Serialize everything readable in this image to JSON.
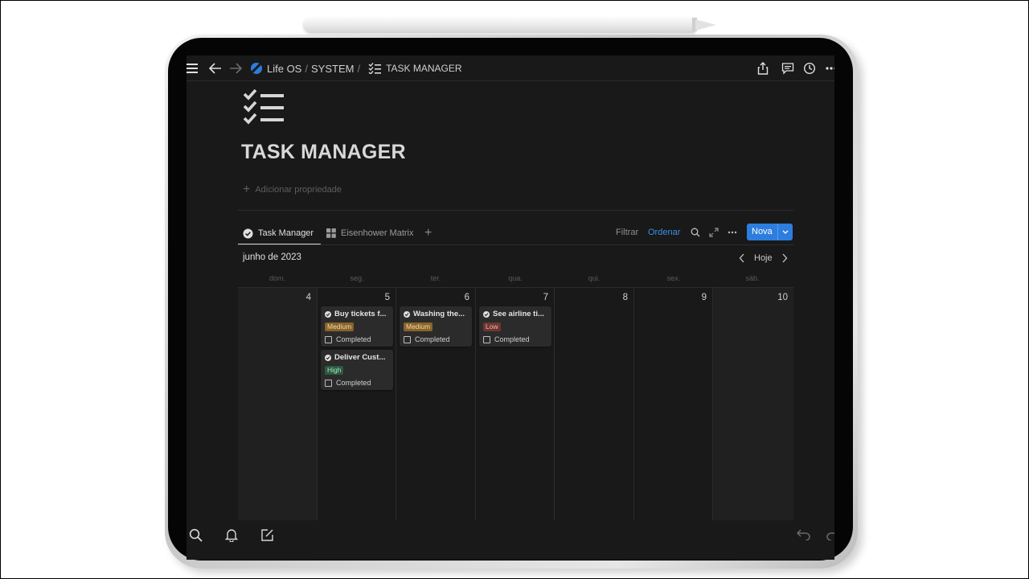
{
  "topbar": {
    "workspace": "Life OS",
    "section": "SYSTEM",
    "separator": "/",
    "page": "TASK MANAGER"
  },
  "page": {
    "title": "TASK MANAGER",
    "add_property": "Adicionar propriedade"
  },
  "views": {
    "tabs": [
      {
        "label": "Task Manager",
        "icon": "check-circle-icon",
        "active": true
      },
      {
        "label": "Eisenhower Matrix",
        "icon": "grid-icon",
        "active": false
      }
    ],
    "filter_label": "Filtrar",
    "sort_label": "Ordenar",
    "new_label": "Nova"
  },
  "calendar": {
    "month": "junho de 2023",
    "today_label": "Hoje",
    "weekdays": [
      "dom.",
      "seg.",
      "ter.",
      "qua.",
      "qui.",
      "sex.",
      "sáb."
    ],
    "days": [
      "4",
      "5",
      "6",
      "7",
      "8",
      "9",
      "10"
    ],
    "cards": [
      {
        "day": "5",
        "title": "Buy tickets f...",
        "priority": "Medium",
        "checkbox_label": "Completed",
        "checked": false
      },
      {
        "day": "5",
        "title": "Deliver Cust...",
        "priority": "High",
        "checkbox_label": "Completed",
        "checked": false
      },
      {
        "day": "6",
        "title": "Washing the...",
        "priority": "Medium",
        "checkbox_label": "Completed",
        "checked": false
      },
      {
        "day": "7",
        "title": "See airline ti...",
        "priority": "Low",
        "checkbox_label": "Completed",
        "checked": false
      }
    ]
  },
  "colors": {
    "background": "#191919",
    "accent": "#2d7dde",
    "priority_medium": "#89632a",
    "priority_high": "#2b593f",
    "priority_low": "#6e3630"
  }
}
